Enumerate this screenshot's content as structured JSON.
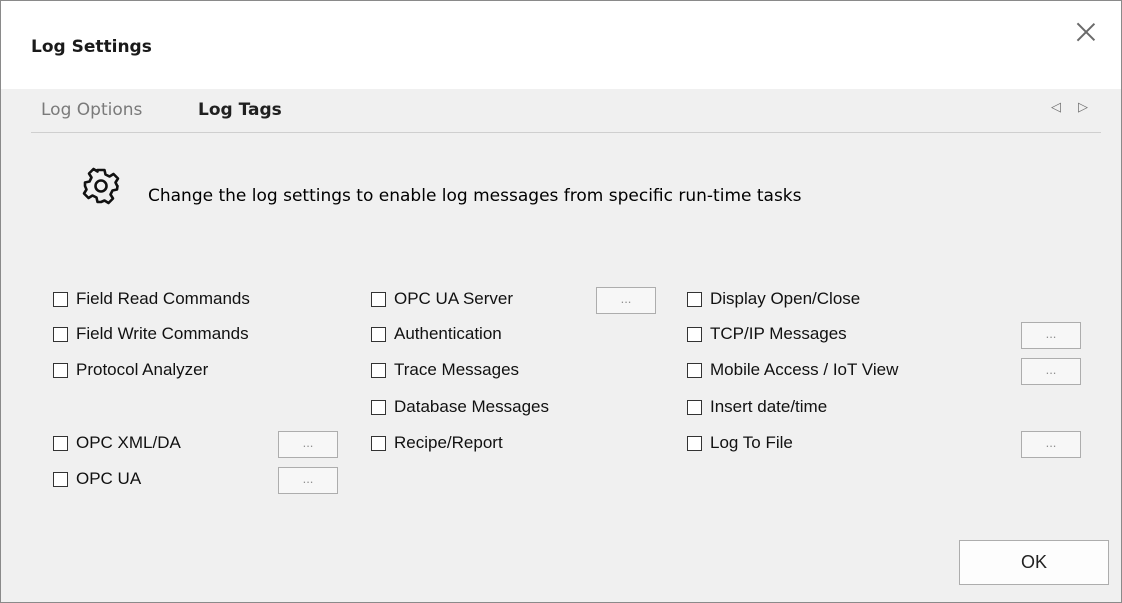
{
  "window": {
    "title": "Log Settings"
  },
  "tabs": [
    {
      "label": "Log Options",
      "active": false
    },
    {
      "label": "Log Tags",
      "active": true
    }
  ],
  "header": {
    "icon": "gear-icon",
    "text": "Change the log settings to enable log messages from specific run-time tasks"
  },
  "options": {
    "field_read": {
      "label": "Field Read Commands",
      "checked": false
    },
    "field_write": {
      "label": "Field Write Commands",
      "checked": false
    },
    "protocol_analyzer": {
      "label": "Protocol Analyzer",
      "checked": false
    },
    "opc_xml_da": {
      "label": "OPC XML/DA",
      "checked": false
    },
    "opc_ua": {
      "label": "OPC UA",
      "checked": false
    },
    "opc_ua_server": {
      "label": "OPC UA Server",
      "checked": false
    },
    "authentication": {
      "label": "Authentication",
      "checked": false
    },
    "trace_messages": {
      "label": "Trace Messages",
      "checked": false
    },
    "database_messages": {
      "label": "Database Messages",
      "checked": false
    },
    "recipe_report": {
      "label": "Recipe/Report",
      "checked": false
    },
    "display_open_close": {
      "label": "Display Open/Close",
      "checked": false
    },
    "tcpip_messages": {
      "label": "TCP/IP Messages",
      "checked": false
    },
    "mobile_access": {
      "label": "Mobile Access / IoT View",
      "checked": false
    },
    "insert_datetime": {
      "label": "Insert date/time",
      "checked": false
    },
    "log_to_file": {
      "label": "Log To File",
      "checked": false
    }
  },
  "ellipsis_label": "...",
  "buttons": {
    "ok": "OK"
  }
}
